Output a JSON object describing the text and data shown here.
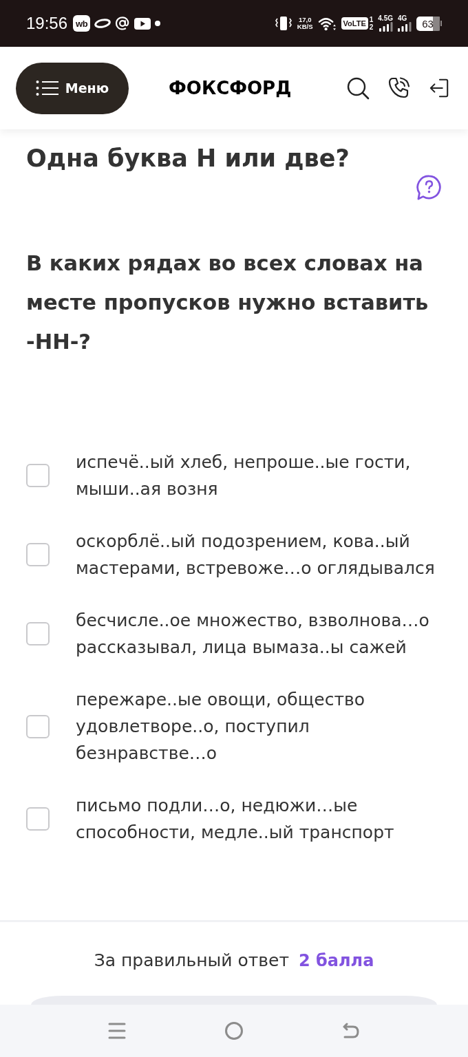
{
  "status_bar": {
    "time": "19:56",
    "app_badge": "wb",
    "network_speed": {
      "value": "17,0",
      "unit": "KB/S"
    },
    "volte": "VoLTE",
    "sim_slots": [
      "1",
      "2"
    ],
    "networks": [
      "4.5G",
      "4G"
    ],
    "battery": "63"
  },
  "header": {
    "menu_button": "Меню",
    "logo": "ФОКСФОРД"
  },
  "task": {
    "title": "Одна буква Н или две?",
    "question": "В каких рядах во всех словах на месте пропусков нужно вставить -НН-?"
  },
  "options": [
    {
      "text": "испечё..ый хлеб, непроше..ые гости, мыши..ая возня",
      "checked": false
    },
    {
      "text": "оскорблё..ый подозрением, кова..ый мастерами, встревоже…о оглядывался",
      "checked": false
    },
    {
      "text": "бесчисле..ое множество, взволнова…о рассказывал, лица вымаза..ы сажей",
      "checked": false
    },
    {
      "text": "пережаре..ые овощи, общество удовлетворе..о, поступил безнравстве…о",
      "checked": false
    },
    {
      "text": "письмо подли…о, недюжи…ые способности, медле..ый транспорт",
      "checked": false
    }
  ],
  "footer": {
    "score_label": "За правильный ответ",
    "score_value": "2 балла"
  }
}
